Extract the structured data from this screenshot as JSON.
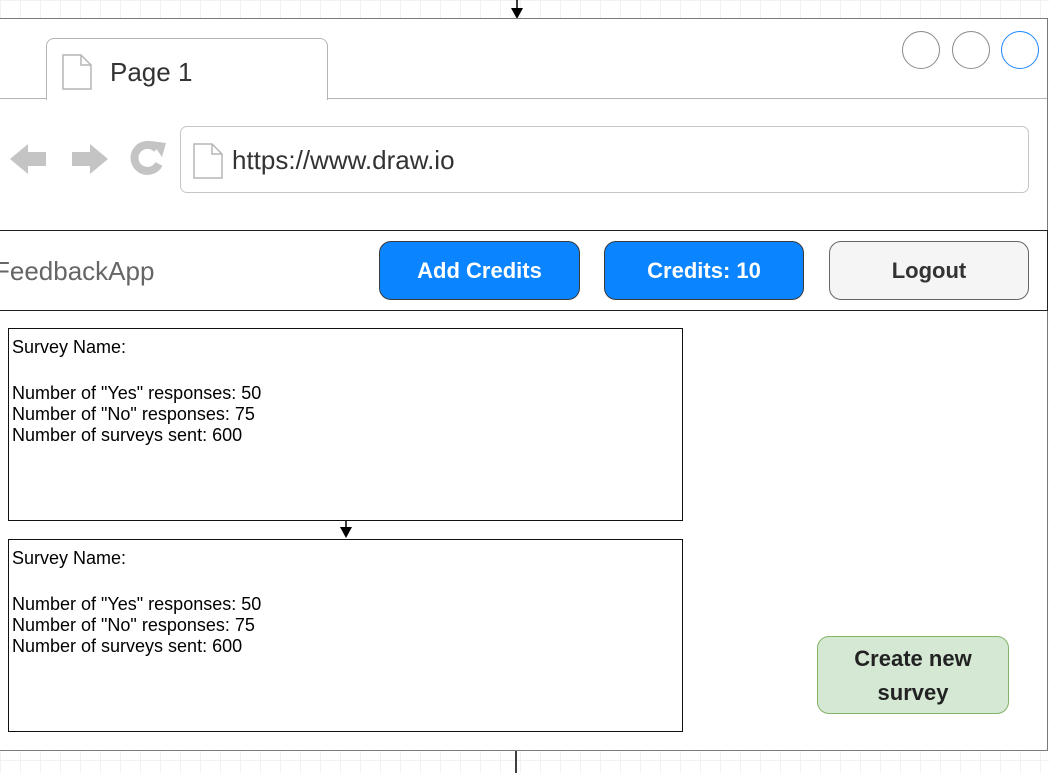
{
  "browser": {
    "tab_label": "Page 1",
    "url": "https://www.draw.io"
  },
  "navbar": {
    "brand": "FeedbackApp",
    "add_credits_label": "Add Credits",
    "credits_label": "Credits: 10",
    "logout_label": "Logout"
  },
  "surveys": [
    {
      "name_label": "Survey Name:",
      "yes_line": "Number of \"Yes\" responses: 50",
      "no_line": "Number of \"No\" responses: 75",
      "sent_line": "Number of surveys sent: 600"
    },
    {
      "name_label": "Survey Name:",
      "yes_line": "Number of \"Yes\" responses: 50",
      "no_line": "Number of \"No\" responses: 75",
      "sent_line": "Number of surveys sent: 600"
    }
  ],
  "create_survey_label": "Create new survey",
  "colors": {
    "primary_button": "#0a84ff",
    "create_button_fill": "#d5e8d4",
    "create_button_border": "#82b366",
    "active_window_circle": "#1e88ff"
  },
  "icons": [
    "back-arrow-icon",
    "forward-arrow-icon",
    "reload-icon",
    "page-icon"
  ]
}
